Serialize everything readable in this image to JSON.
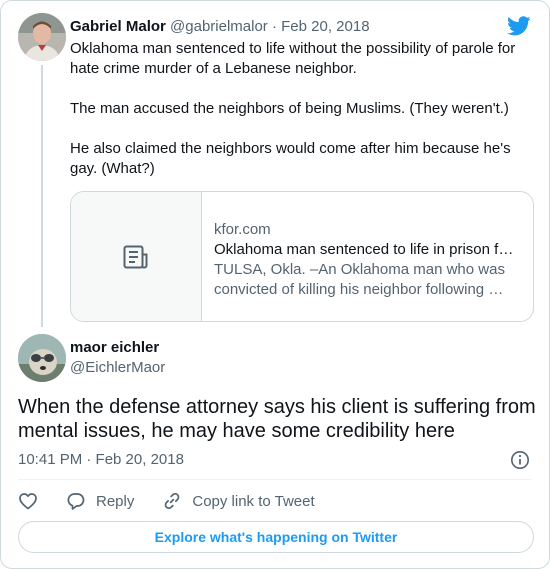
{
  "parent_tweet": {
    "author_name": "Gabriel Malor",
    "author_handle": "@gabrielmalor",
    "separator": "·",
    "date": "Feb 20, 2018",
    "paragraphs": [
      "Oklahoma man sentenced to life without the possibility of parole for hate crime murder of a Lebanese neighbor.",
      "The man accused the neighbors of being Muslims. (They weren't.)",
      "He also claimed the neighbors would come after him because he's gay. (What?)"
    ],
    "link_card": {
      "domain": "kfor.com",
      "title": "Oklahoma man sentenced to life in prison fo…",
      "description_line1": "TULSA, Okla. –An Oklahoma man who was",
      "description_line2": "convicted of killing his neighbor following …",
      "thumb_icon": "article-icon"
    }
  },
  "reply_tweet": {
    "author_name": "maor eichler",
    "author_handle": "@EichlerMaor",
    "text": "When the defense attorney says his client is suffering from mental issues, he may have some credibility here",
    "timestamp": "10:41 PM · Feb 20, 2018"
  },
  "actions": {
    "like_icon": "heart-icon",
    "reply_label": "Reply",
    "copy_link_label": "Copy link to Tweet"
  },
  "explore_label": "Explore what's happening on Twitter",
  "colors": {
    "accent": "#1d9bf0",
    "text_primary": "#0f1419",
    "text_secondary": "#536471",
    "border": "#cfd9de"
  }
}
